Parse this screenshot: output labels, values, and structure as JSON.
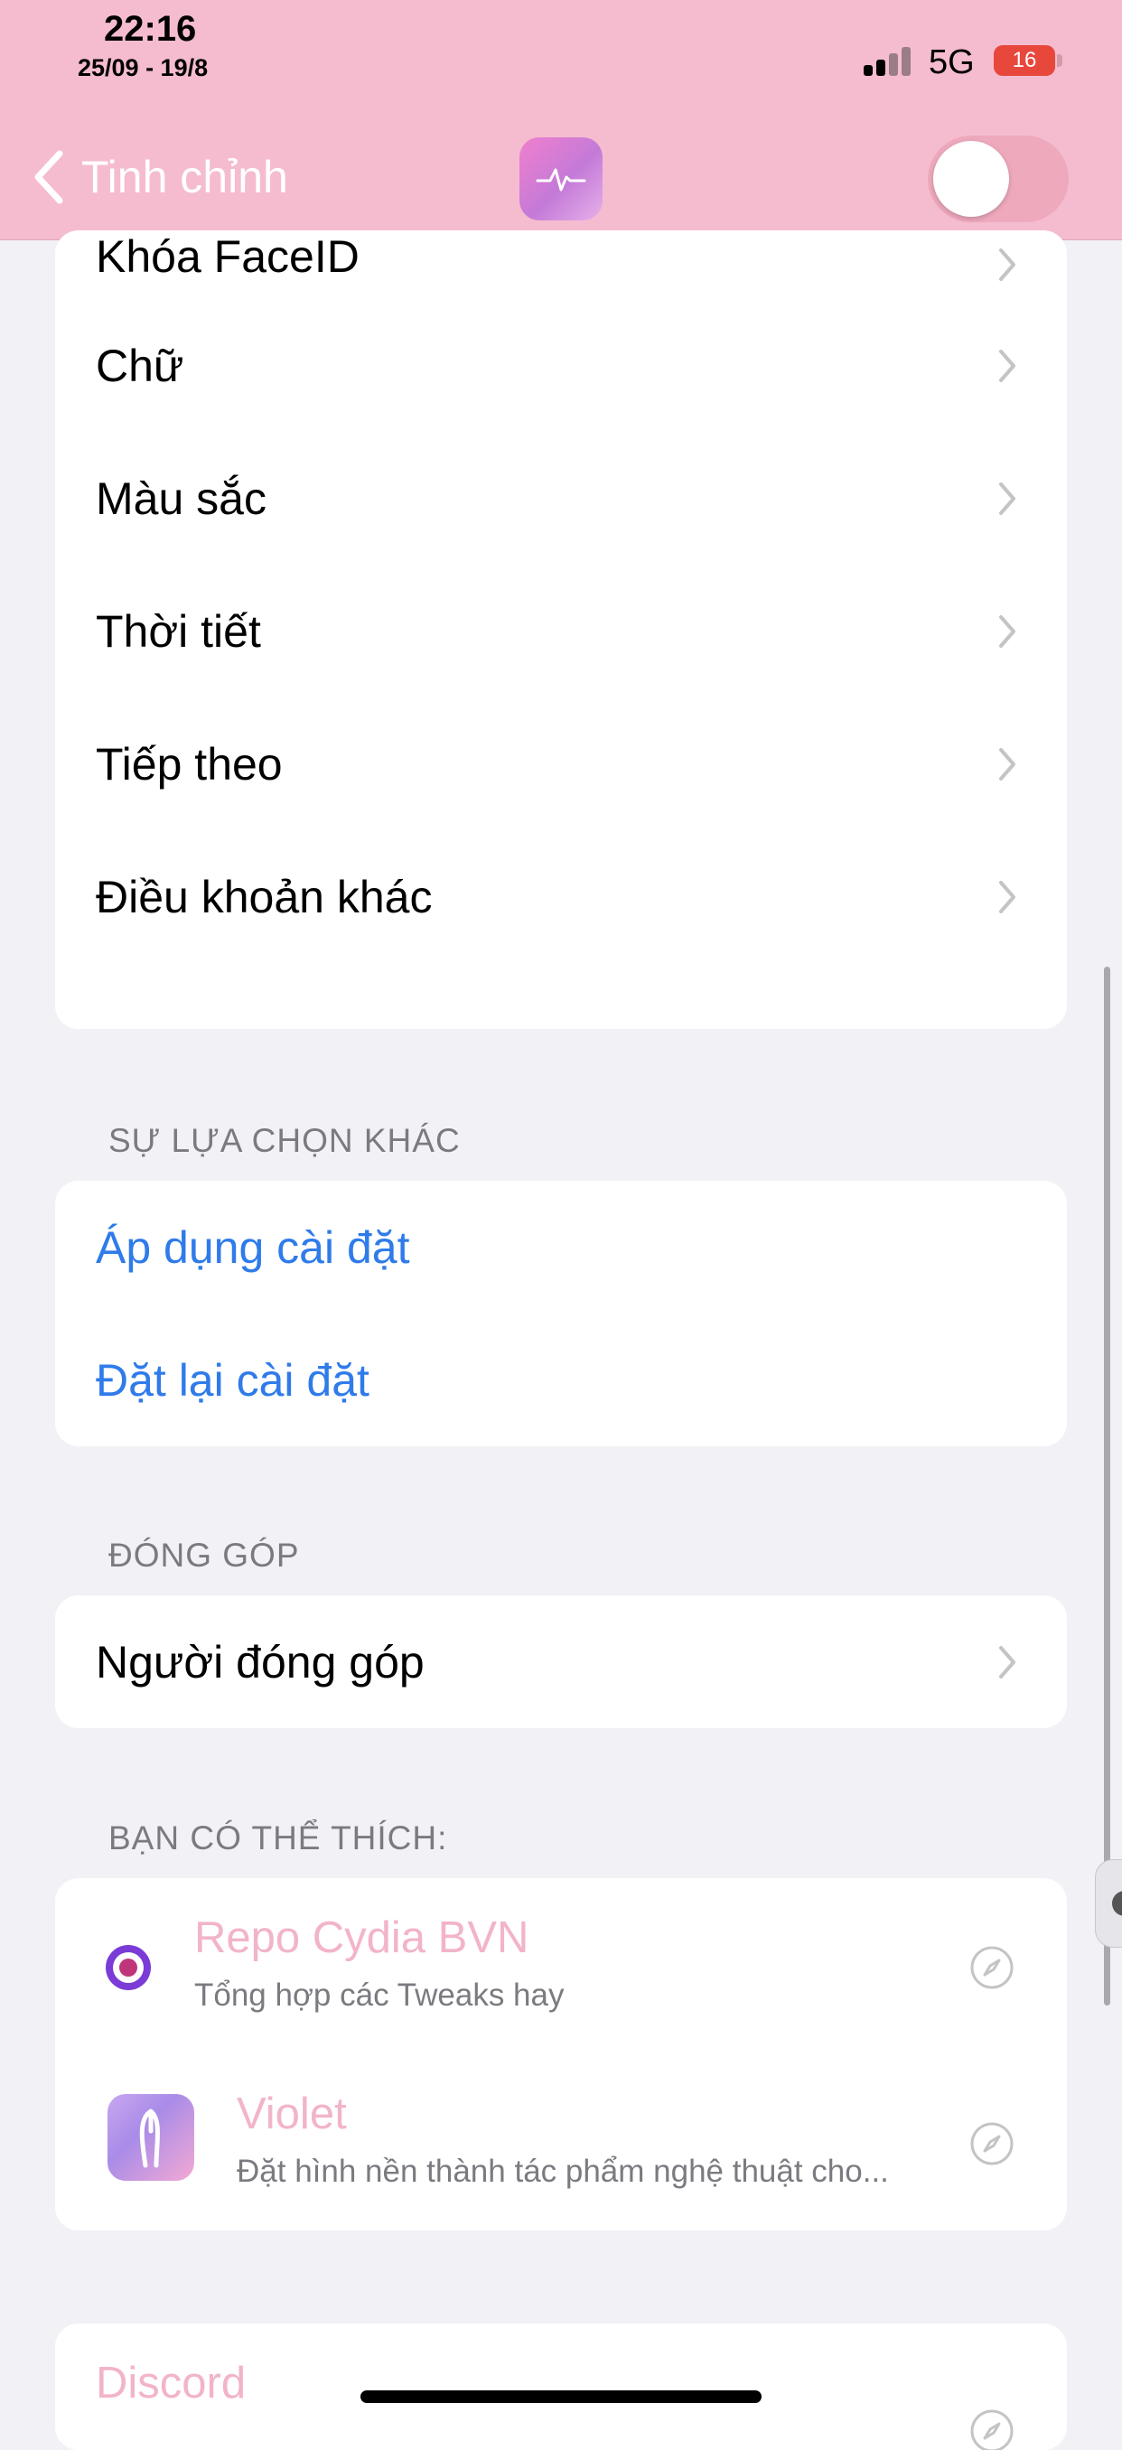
{
  "status_bar": {
    "time": "22:16",
    "date": "25/09 - 19/8",
    "network": "5G",
    "battery": "16"
  },
  "nav": {
    "back_label": "Tinh chỉnh",
    "app_icon": "waveform-icon",
    "toggle_on": false
  },
  "menu": {
    "items": [
      {
        "label": "Khóa FaceID"
      },
      {
        "label": "Chữ"
      },
      {
        "label": "Màu sắc"
      },
      {
        "label": "Thời tiết"
      },
      {
        "label": "Tiếp theo"
      },
      {
        "label": "Điều khoản khác"
      }
    ]
  },
  "other_options": {
    "header": "SỰ LỰA CHỌN KHÁC",
    "apply": "Áp dụng cài đặt",
    "reset": "Đặt lại cài đặt"
  },
  "contribute": {
    "header": "ĐÓNG GÓP",
    "contributors": "Người đóng góp"
  },
  "suggestions": {
    "header": "BẠN CÓ THỂ THÍCH:",
    "items": [
      {
        "title": "Repo Cydia BVN",
        "subtitle": "Tổng hợp các Tweaks hay"
      },
      {
        "title": "Violet",
        "subtitle": "Đặt hình nền thành tác phẩm nghệ thuật cho..."
      }
    ],
    "discord": "Discord"
  },
  "colors": {
    "topbar": "#f5bccf",
    "accent_blue": "#2f7bea",
    "suggestion_pink": "#f2b4c9",
    "battery_red": "#e8473c"
  }
}
